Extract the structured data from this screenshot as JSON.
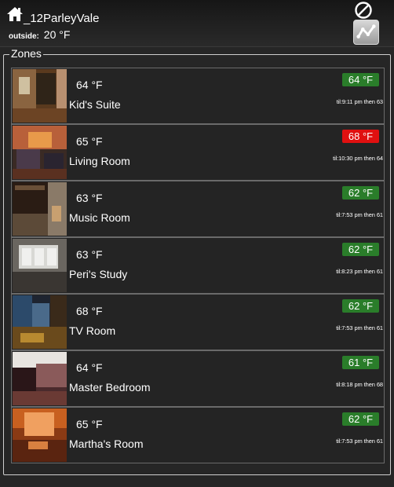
{
  "header": {
    "house_name": "_12ParleyVale",
    "outside_label": "outside:",
    "outside_temp": "20 °F",
    "home_icon": "home-icon",
    "off_icon": "power-off-icon",
    "graph_icon": "line-graph-icon"
  },
  "zones_legend": "Zones",
  "colors": {
    "setpoint_green": "#2a7d2a",
    "setpoint_red": "#e01010"
  },
  "zones": [
    {
      "name": "Kid's Suite",
      "temp": "64 °F",
      "setpoint": "64 °F",
      "status": "green",
      "schedule": "til:9:11 pm then 63"
    },
    {
      "name": "Living Room",
      "temp": "65 °F",
      "setpoint": "68 °F",
      "status": "red",
      "schedule": "til:10:30 pm then 64"
    },
    {
      "name": "Music Room",
      "temp": "63 °F",
      "setpoint": "62 °F",
      "status": "green",
      "schedule": "til:7:53 pm then 61"
    },
    {
      "name": "Peri's Study",
      "temp": "63 °F",
      "setpoint": "62 °F",
      "status": "green",
      "schedule": "til:8:23 pm then 61"
    },
    {
      "name": "TV Room",
      "temp": "68 °F",
      "setpoint": "62 °F",
      "status": "green",
      "schedule": "til:7:53 pm then 61"
    },
    {
      "name": "Master Bedroom",
      "temp": "64 °F",
      "setpoint": "61 °F",
      "status": "green",
      "schedule": "til:8:18 pm then 68"
    },
    {
      "name": "Martha's Room",
      "temp": "65 °F",
      "setpoint": "62 °F",
      "status": "green",
      "schedule": "til:7:53 pm then 61"
    }
  ]
}
